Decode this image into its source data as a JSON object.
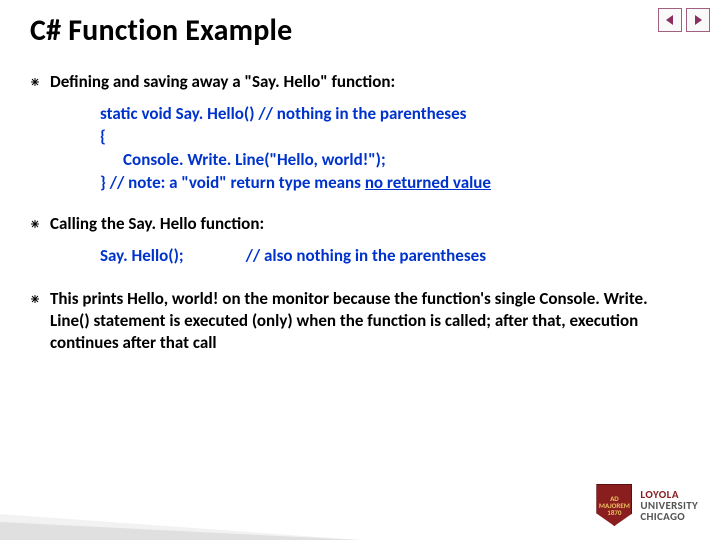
{
  "title": "C# Function Example",
  "bullets": {
    "b1": "Defining and saving away a \"Say. Hello\" function:",
    "b2": "Calling the Say. Hello function:",
    "b3": "This prints Hello, world! on the monitor because the function's single Console. Write. Line() statement is executed (only) when the function is called; after that, execution continues after that call"
  },
  "code": {
    "line1": "static void Say. Hello() // nothing in the parentheses",
    "line2": "{",
    "line3": "      Console. Write. Line(\"Hello, world!\");",
    "line4_prefix": "} // note: a \"void\" return type means ",
    "line4_underlined": "no returned value"
  },
  "call": {
    "invoke": "Say. Hello();",
    "comment": "// also nothing in the parentheses"
  },
  "logo": {
    "line1": "LOYOLA",
    "line2": "UNIVERSITY",
    "line3": "CHICAGO",
    "shield_year": "1870",
    "shield_motto": "AD MAJOREM"
  },
  "nav": {
    "prev": "previous",
    "next": "next"
  }
}
